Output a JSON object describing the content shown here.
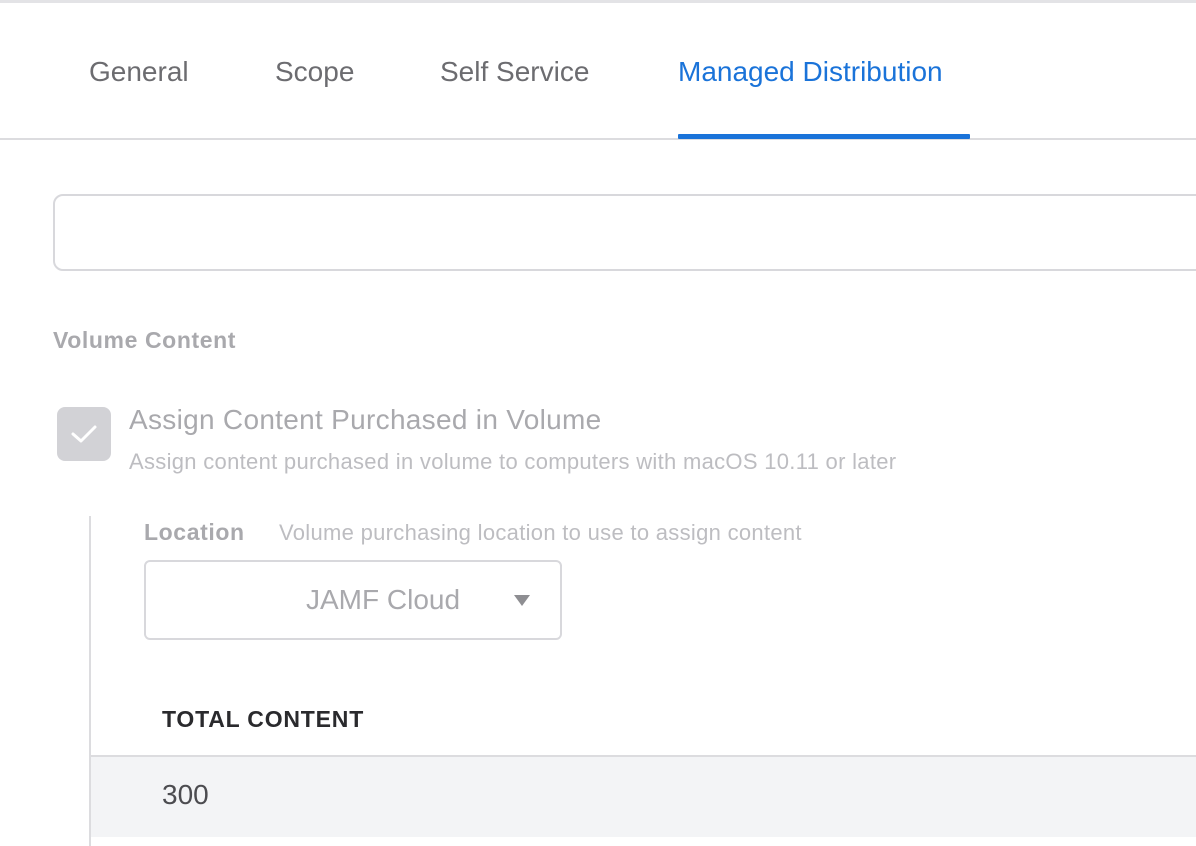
{
  "tabs": [
    {
      "label": "General",
      "active": false
    },
    {
      "label": "Scope",
      "active": false
    },
    {
      "label": "Self Service",
      "active": false
    },
    {
      "label": "Managed Distribution",
      "active": true
    }
  ],
  "volume_content": {
    "section_title": "Volume Content",
    "assign_checkbox": {
      "checked": true,
      "label": "Assign Content Purchased in Volume",
      "description": "Assign content purchased in volume to computers with macOS 10.11 or later"
    },
    "location": {
      "label": "Location",
      "description": "Volume purchasing location to use to assign content",
      "selected_value": "JAMF Cloud"
    },
    "table": {
      "columns": [
        "TOTAL CONTENT"
      ],
      "rows": [
        [
          "300"
        ]
      ]
    }
  },
  "colors": {
    "accent": "#1a73d9",
    "muted_text": "#a9a9ad",
    "border": "#d8d8dc",
    "row_background": "#f3f4f6"
  }
}
